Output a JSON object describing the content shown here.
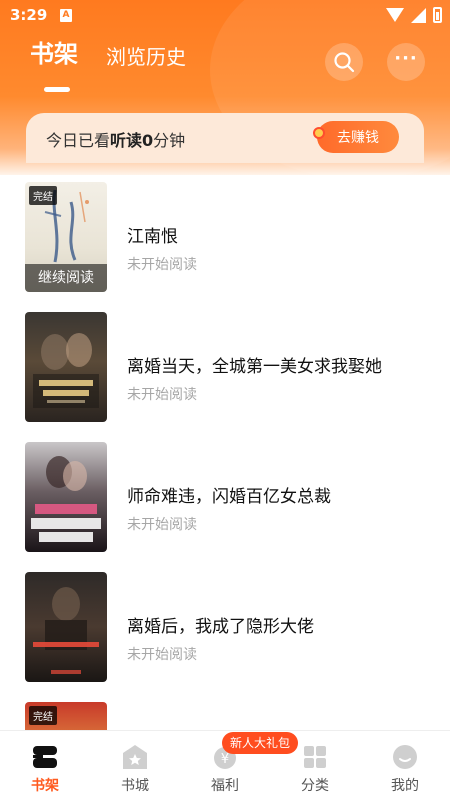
{
  "status_bar": {
    "time": "3:29",
    "notification_badge": "A"
  },
  "header": {
    "tabs": [
      {
        "label": "书架",
        "active": true
      },
      {
        "label": "浏览历史",
        "active": false
      }
    ],
    "search_icon": "search-icon",
    "more_icon": "more-icon",
    "more_glyph": "···"
  },
  "reading_banner": {
    "text_prefix": "今日已看",
    "text_bold_1": "听读",
    "text_minutes": "0",
    "text_suffix": "分钟",
    "earn_button": "去赚钱"
  },
  "books": [
    {
      "title": "江南恨",
      "status": "未开始阅读",
      "badge": "完结",
      "cover_caption": "继续阅读"
    },
    {
      "title": "离婚当天，全城第一美女求我娶她",
      "status": "未开始阅读"
    },
    {
      "title": "师命难违，闪婚百亿女总裁",
      "status": "未开始阅读"
    },
    {
      "title": "离婚后，我成了隐形大佬",
      "status": "未开始阅读"
    },
    {
      "badge": "完结"
    }
  ],
  "bottom_nav": {
    "items": [
      {
        "label": "书架",
        "icon": "bookshelf-icon",
        "active": true
      },
      {
        "label": "书城",
        "icon": "bookstore-icon",
        "active": false
      },
      {
        "label": "福利",
        "icon": "welfare-icon",
        "active": false
      },
      {
        "label": "分类",
        "icon": "category-icon",
        "active": false
      },
      {
        "label": "我的",
        "icon": "profile-icon",
        "active": false
      }
    ],
    "welfare_badge": "新人大礼包"
  },
  "colors": {
    "accent": "#ff5a1f",
    "header_orange": "#ff7a1f",
    "banner_bg": "#fde9d9",
    "muted_text": "#a6a6a6"
  }
}
